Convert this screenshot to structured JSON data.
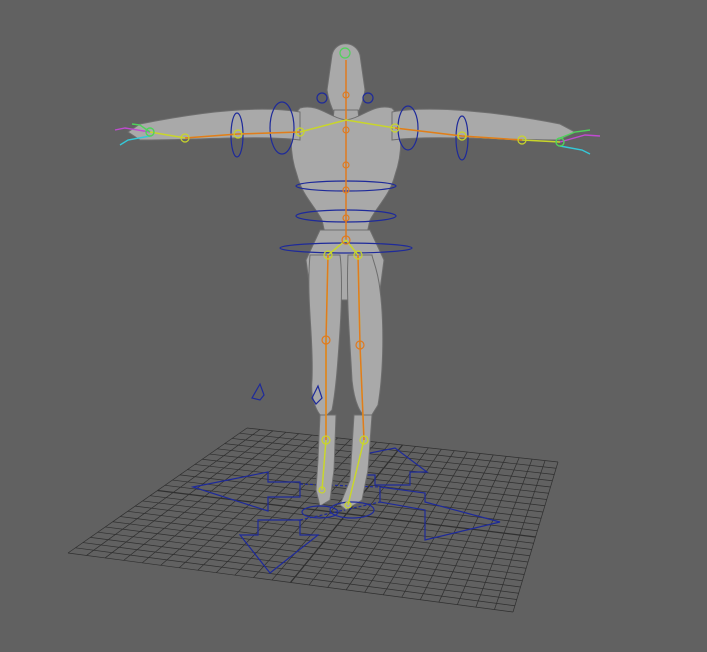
{
  "viewport": {
    "background_color": "#616161",
    "grid_color": "#2f2f2f",
    "model_color": "#a9a9a9",
    "model_shadow_color": "#6e6e6e",
    "control_curve_color": "#1e2a9a",
    "joint_color_orange": "#e07a1f",
    "joint_color_yellow": "#c9d62a",
    "joint_color_green": "#4fd35a",
    "hand_color_magenta": "#c04bd0",
    "hand_color_cyan": "#35c8d8",
    "model_name": ""
  }
}
